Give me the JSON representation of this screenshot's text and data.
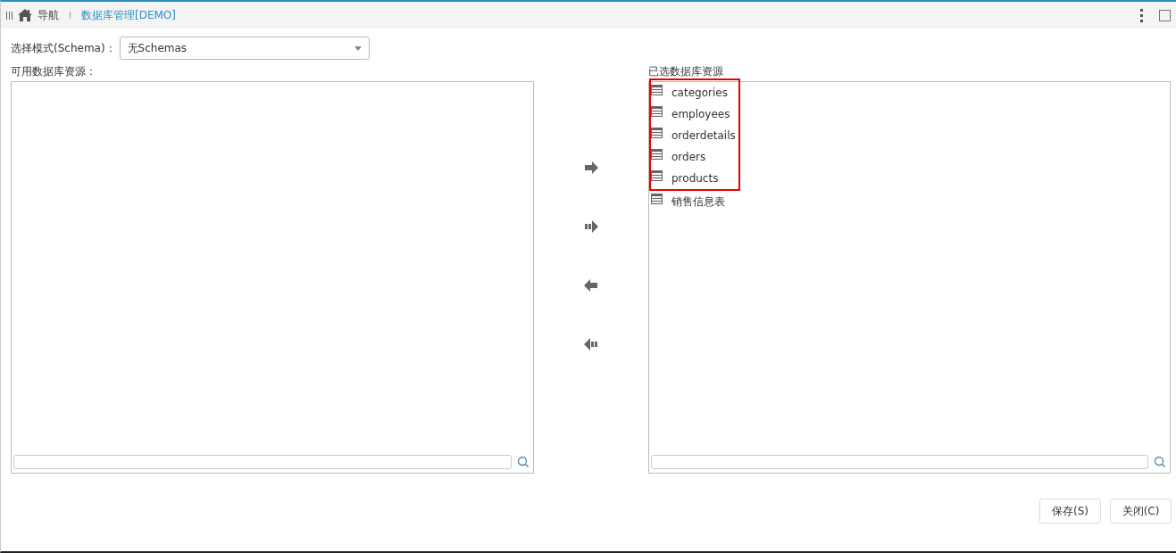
{
  "header": {
    "nav_label": "导航",
    "page_title": "数据库管理[DEMO]"
  },
  "schema": {
    "label": "选择模式(Schema)：",
    "value": "无Schemas"
  },
  "available": {
    "title": "可用数据库资源："
  },
  "transfer_buttons": [
    {
      "kind": "add"
    },
    {
      "kind": "add-all"
    },
    {
      "kind": "remove"
    },
    {
      "kind": "remove-all"
    }
  ],
  "selected": {
    "title": "已选数据库资源",
    "items": [
      {
        "label": "categories",
        "highlighted": true
      },
      {
        "label": "employees",
        "highlighted": true
      },
      {
        "label": "orderdetails",
        "highlighted": true
      },
      {
        "label": "orders",
        "highlighted": true
      },
      {
        "label": "products",
        "highlighted": true
      },
      {
        "label": "销售信息表",
        "highlighted": false
      }
    ]
  },
  "buttons": [
    "保存(S)",
    "关闭(C)"
  ]
}
